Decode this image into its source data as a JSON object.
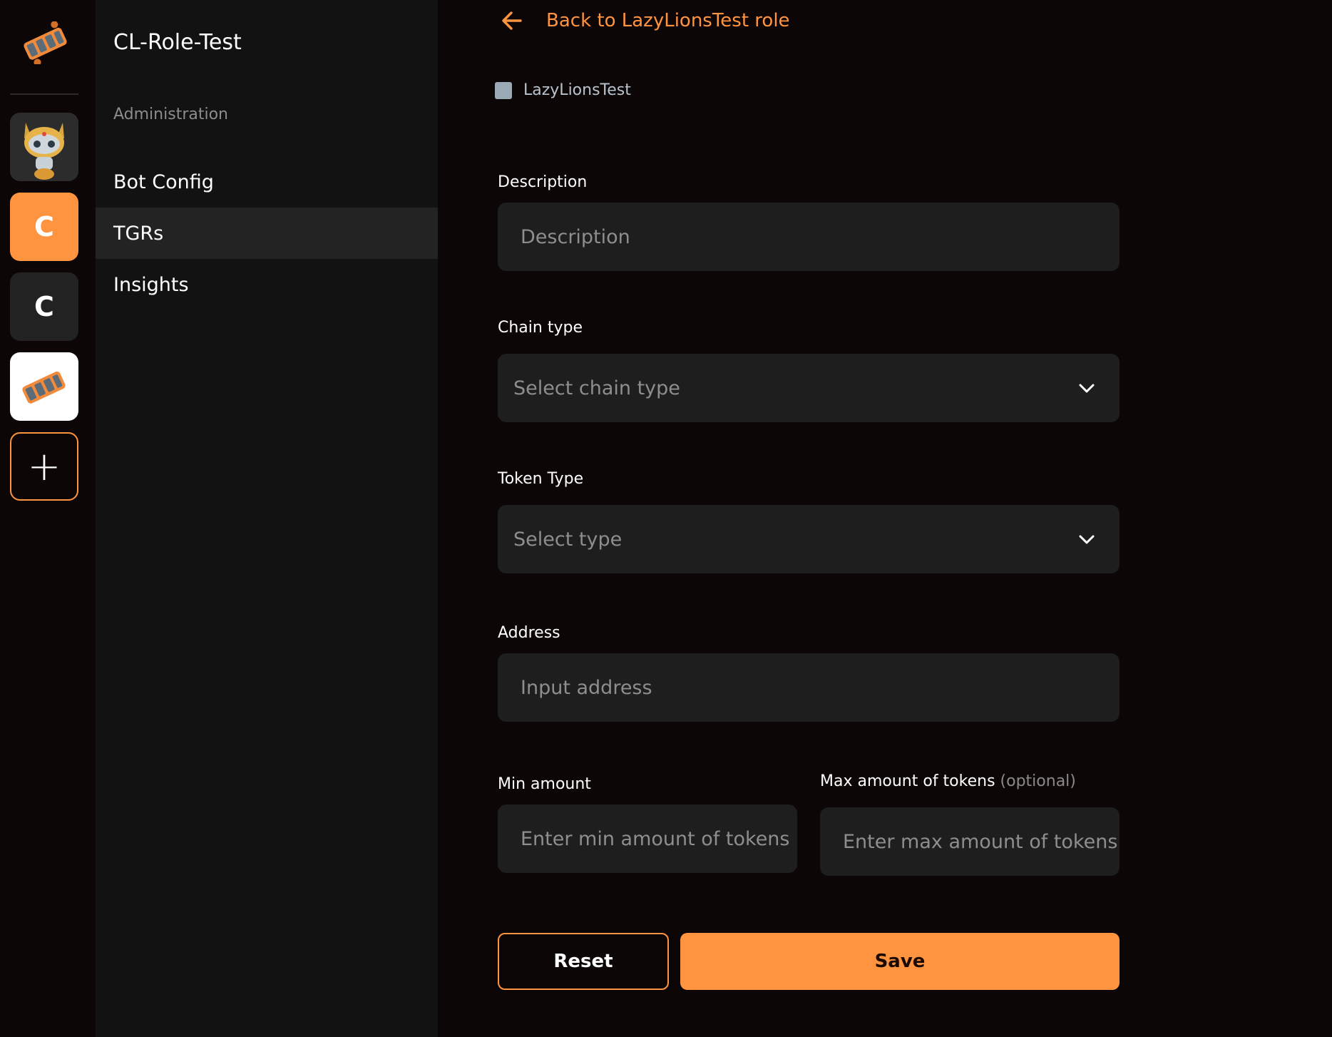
{
  "rail": {
    "logo_icon": "hand-chain-logo-icon",
    "avatar_icon": "robot-mascot-avatar",
    "servers": [
      {
        "letter": "C",
        "active": true
      },
      {
        "letter": "C",
        "active": false
      }
    ],
    "add_symbol": "+"
  },
  "sidebar": {
    "server_name": "CL-Role-Test",
    "section_label": "Administration",
    "items": [
      {
        "label": "Bot Config"
      },
      {
        "label": "TGRs"
      },
      {
        "label": "Insights"
      }
    ]
  },
  "main": {
    "back_label": "Back to LazyLionsTest role",
    "role_name": "LazyLionsTest",
    "role_color": "#99aab5",
    "description": {
      "label": "Description",
      "placeholder": "Description"
    },
    "chain_type": {
      "label": "Chain type",
      "placeholder": "Select chain type"
    },
    "token_type": {
      "label": "Token Type",
      "placeholder": "Select type"
    },
    "address": {
      "label": "Address",
      "placeholder": "Input address"
    },
    "min_amount": {
      "label": "Min amount",
      "placeholder": "Enter min amount of tokens"
    },
    "max_amount": {
      "label": "Max amount of tokens",
      "optional": "(optional)",
      "placeholder": "Enter max amount of tokens"
    },
    "reset_label": "Reset",
    "save_label": "Save"
  },
  "colors": {
    "accent": "#fe9340",
    "background": "#0d0606",
    "sidebar": "#121212",
    "input": "#1e1e1e"
  }
}
